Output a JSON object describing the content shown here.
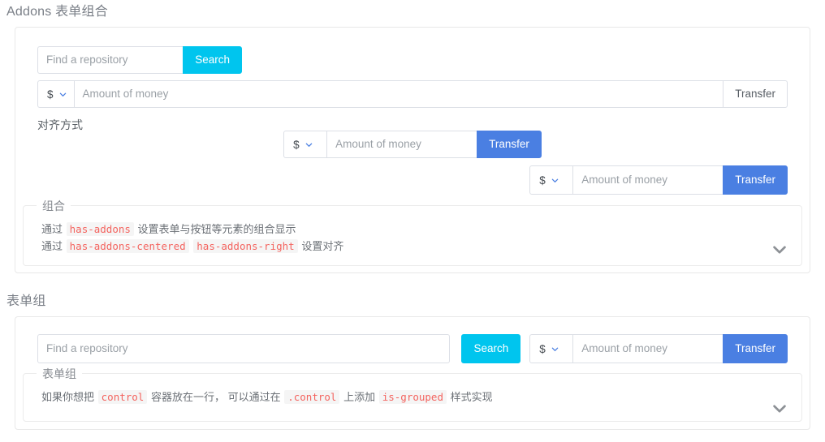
{
  "sections": [
    {
      "title": "Addons 表单组合",
      "search": {
        "placeholder": "Find a repository",
        "button": "Search"
      },
      "amount": {
        "currency": "$",
        "placeholder": "Amount of money",
        "button": "Transfer"
      },
      "align_label": "对齐方式",
      "centered": {
        "currency": "$",
        "placeholder": "Amount of money",
        "button": "Transfer"
      },
      "right": {
        "currency": "$",
        "placeholder": "Amount of money",
        "button": "Transfer"
      },
      "info": {
        "legend": "组合",
        "line1_pre": "通过",
        "line1_code": "has-addons",
        "line1_post": "设置表单与按钮等元素的组合显示",
        "line2_pre": "通过",
        "line2_code1": "has-addons-centered",
        "line2_code2": "has-addons-right",
        "line2_post": "设置对齐"
      }
    },
    {
      "title": "表单组",
      "search": {
        "placeholder": "Find a repository",
        "button": "Search"
      },
      "amount": {
        "currency": "$",
        "placeholder": "Amount of money",
        "button": "Transfer"
      },
      "info": {
        "legend": "表单组",
        "line_pre": "如果你想把",
        "code1": "control",
        "line_mid1": "容器放在一行，",
        "line_mid2": "可以通过在",
        "code2": ".control",
        "line_mid3": "上添加",
        "code3": "is-grouped",
        "line_post": "样式实现"
      }
    }
  ],
  "icons": {
    "select_chevron": "chevron-down-icon",
    "expand_chevron": "chevron-down-icon"
  },
  "colors": {
    "info_button": "#00c5ee",
    "link_button": "#4a7fe2",
    "code_text": "#f4645f",
    "border": "#dcdfe6"
  }
}
